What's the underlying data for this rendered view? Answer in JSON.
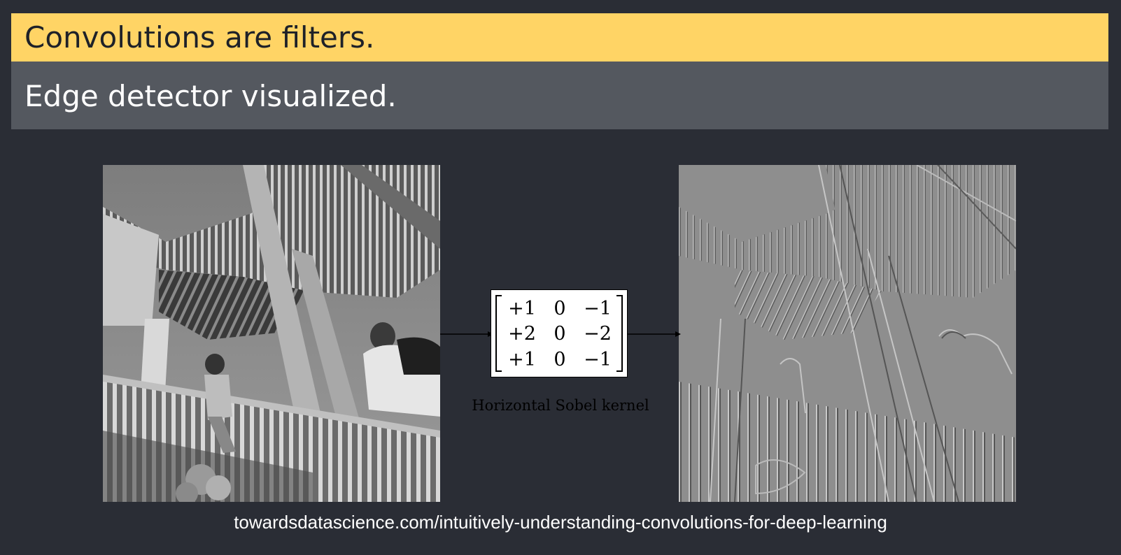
{
  "slide": {
    "title": "Convolutions are filters.",
    "subtitle": "Edge detector visualized."
  },
  "figure": {
    "input_image_icon": "grayscale-staircase-photo",
    "output_image_icon": "edge-map-photo",
    "kernel": {
      "rows": [
        [
          "+1",
          "0",
          "−1"
        ],
        [
          "+2",
          "0",
          "−2"
        ],
        [
          "+1",
          "0",
          "−1"
        ]
      ],
      "caption": "Horizontal Sobel kernel"
    }
  },
  "source": "towardsdatascience.com/intuitively-understanding-convolutions-for-deep-learning",
  "colors": {
    "title_bar": "#ffd465",
    "subtitle_bar": "#54585f",
    "background": "#2a2d35"
  }
}
